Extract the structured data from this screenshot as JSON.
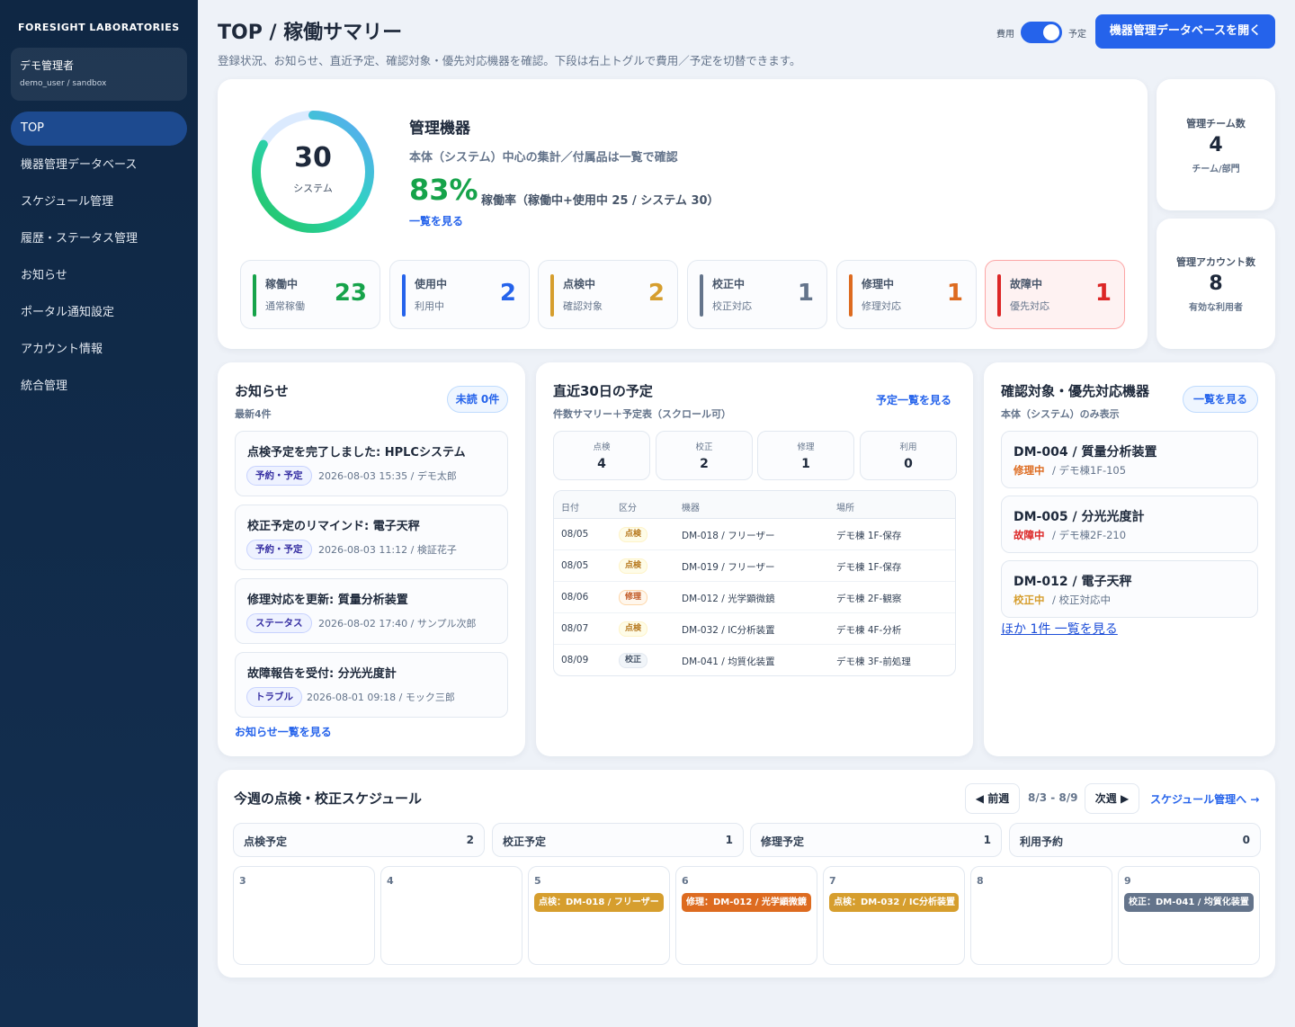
{
  "sidebar": {
    "brand": "FORESIGHT LABORATORIES",
    "user_name": "デモ管理者",
    "user_sub": "demo_user / sandbox",
    "items": [
      "TOP",
      "機器管理データベース",
      "スケジュール管理",
      "履歴・ステータス管理",
      "お知らせ",
      "ポータル通知設定",
      "アカウント情報",
      "統合管理"
    ]
  },
  "header": {
    "title": "TOP / 稼働サマリー",
    "subtitle": "登録状況、お知らせ、直近予定、確認対象・優先対応機器を確認。下段は右上トグルで費用／予定を切替できます。",
    "toggle_left": "費用",
    "toggle_right": "予定",
    "toggle_state": "予定",
    "db_button": "機器管理データベースを開く"
  },
  "summary": {
    "total": "30",
    "total_label": "システム",
    "operating_ratio": 0.83,
    "title": "管理機器",
    "subtitle": "本体（システム）中心の集計／付属品は一覧で確認",
    "percent": "83%",
    "percent_label": "稼働率（稼働中+使用中 25 / システム 30）",
    "link": "一覧を見る",
    "stats": [
      {
        "label": "稼働中",
        "sub": "通常稼働",
        "value": "23",
        "color": "#16a34a"
      },
      {
        "label": "使用中",
        "sub": "利用中",
        "value": "2",
        "color": "#2563eb"
      },
      {
        "label": "点検中",
        "sub": "確認対象",
        "value": "2",
        "color": "#d69e2e"
      },
      {
        "label": "校正中",
        "sub": "校正対応",
        "value": "1",
        "color": "#64748b"
      },
      {
        "label": "修理中",
        "sub": "修理対応",
        "value": "1",
        "color": "#dd6b20"
      },
      {
        "label": "故障中",
        "sub": "優先対応",
        "value": "1",
        "color": "#dc2626"
      }
    ]
  },
  "side_stats": {
    "teams_title": "管理チーム数",
    "teams_value": "4",
    "teams_sub": "チーム/部門",
    "accounts_title": "管理アカウント数",
    "accounts_value": "8",
    "accounts_sub": "有効な利用者"
  },
  "notices": {
    "title": "お知らせ",
    "sub": "最新4件",
    "unread": "未読 0件",
    "items": [
      {
        "title": "点検予定を完了しました: HPLCシステム",
        "tag": "予約・予定",
        "meta": "2026-08-03 15:35 / デモ太郎"
      },
      {
        "title": "校正予定のリマインド: 電子天秤",
        "tag": "予約・予定",
        "meta": "2026-08-03 11:12 / 検証花子"
      },
      {
        "title": "修理対応を更新: 質量分析装置",
        "tag": "ステータス",
        "meta": "2026-08-02 17:40 / サンプル次郎"
      },
      {
        "title": "故障報告を受付: 分光光度計",
        "tag": "トラブル",
        "meta": "2026-08-01 09:18 / モック三郎"
      }
    ],
    "link": "お知らせ一覧を見る"
  },
  "upcoming": {
    "title": "直近30日の予定",
    "sub": "件数サマリー＋予定表（スクロール可）",
    "link": "予定一覧を見る",
    "counts": [
      {
        "label": "点検",
        "value": "4"
      },
      {
        "label": "校正",
        "value": "2"
      },
      {
        "label": "修理",
        "value": "1"
      },
      {
        "label": "利用",
        "value": "0"
      }
    ],
    "columns": [
      "日付",
      "区分",
      "機器",
      "場所"
    ],
    "rows": [
      {
        "date": "08/05",
        "kind": "点検",
        "device": "DM-018 / フリーザー",
        "place": "デモ棟 1F-保存"
      },
      {
        "date": "08/05",
        "kind": "点検",
        "device": "DM-019 / フリーザー",
        "place": "デモ棟 1F-保存"
      },
      {
        "date": "08/06",
        "kind": "修理",
        "device": "DM-012 / 光学顕微鏡",
        "place": "デモ棟 2F-観察"
      },
      {
        "date": "08/07",
        "kind": "点検",
        "device": "DM-032 / IC分析装置",
        "place": "デモ棟 4F-分析"
      },
      {
        "date": "08/09",
        "kind": "校正",
        "device": "DM-041 / 均質化装置",
        "place": "デモ棟 3F-前処理"
      }
    ]
  },
  "priority": {
    "title": "確認対象・優先対応機器",
    "sub": "本体（システム）のみ表示",
    "link": "一覧を見る",
    "items": [
      {
        "id": "DM-004",
        "name": "質量分析装置",
        "status": "修理中",
        "location": "デモ棟1F-105",
        "color": "#dd6b20"
      },
      {
        "id": "DM-005",
        "name": "分光光度計",
        "status": "故障中",
        "location": "デモ棟2F-210",
        "color": "#dc2626"
      },
      {
        "id": "DM-012",
        "name": "電子天秤",
        "status": "校正中",
        "location": "校正対応中",
        "color": "#d69e2e"
      }
    ],
    "more": "ほか 1件 一覧を見る"
  },
  "week": {
    "title": "今週の点検・校正スケジュール",
    "prev": "◀ 前週",
    "range": "8/3 - 8/9",
    "next": "次週 ▶",
    "link": "スケジュール管理へ →",
    "summary": [
      {
        "label": "点検予定",
        "value": "2"
      },
      {
        "label": "校正予定",
        "value": "1"
      },
      {
        "label": "修理予定",
        "value": "1"
      },
      {
        "label": "利用予約",
        "value": "0"
      }
    ],
    "days": [
      {
        "day": "3",
        "event": ""
      },
      {
        "day": "4",
        "event": ""
      },
      {
        "day": "5",
        "event": "点検：DM-018 / フリーザー",
        "color": "#d69e2e"
      },
      {
        "day": "6",
        "event": "修理：DM-012 / 光学顕微鏡",
        "color": "#dd6b20"
      },
      {
        "day": "7",
        "event": "点検：DM-032 / IC分析装置",
        "color": "#d69e2e"
      },
      {
        "day": "8",
        "event": ""
      },
      {
        "day": "9",
        "event": "校正：DM-041 / 均質化装置",
        "color": "#64748b"
      }
    ]
  },
  "colors": {
    "accent": "#2563eb",
    "sidebar": "#0f2744",
    "success": "#16a34a",
    "warning": "#d69e2e",
    "repair": "#dd6b20",
    "danger": "#dc2626",
    "neutral": "#64748b"
  },
  "icons": {
    "nav": "none"
  }
}
